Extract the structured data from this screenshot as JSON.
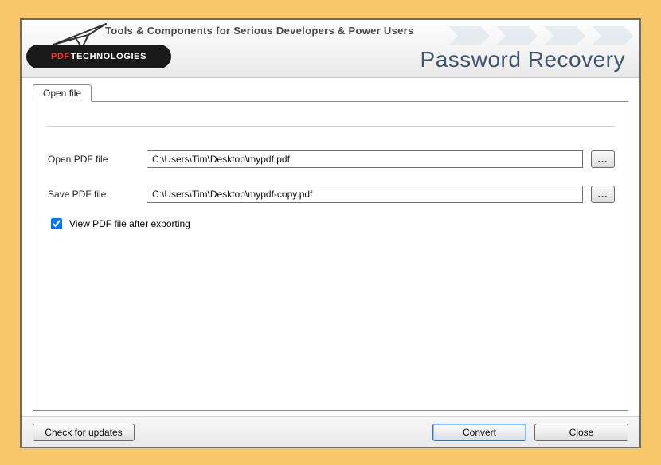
{
  "header": {
    "tagline": "Tools & Components for Serious Developers & Power Users",
    "app_title": "Password Recovery",
    "logo_prefix": "PDF",
    "logo_suffix": "TECHNOLOGIES"
  },
  "tab": {
    "label": "Open file"
  },
  "form": {
    "open_label": "Open PDF file",
    "open_value": "C:\\Users\\Tim\\Desktop\\mypdf.pdf",
    "save_label": "Save PDF file",
    "save_value": "C:\\Users\\Tim\\Desktop\\mypdf-copy.pdf",
    "browse_label": "...",
    "view_after_label": "View PDF file after exporting",
    "view_after_checked": true
  },
  "footer": {
    "updates_label": "Check for updates",
    "convert_label": "Convert",
    "close_label": "Close"
  }
}
